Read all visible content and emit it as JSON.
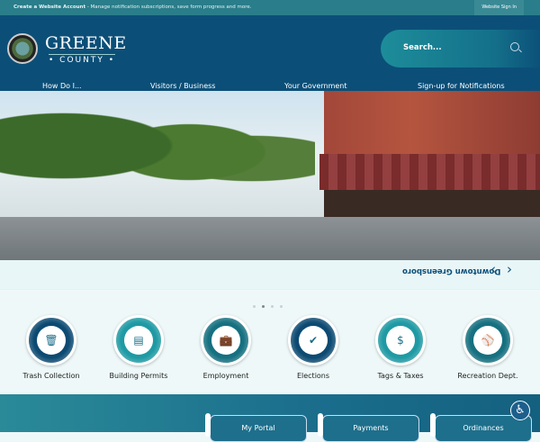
{
  "topbar": {
    "account_label": "Create a Website Account",
    "account_desc": " - Manage notification subscriptions, save form progress and more.",
    "signin": "Website Sign In"
  },
  "logo": {
    "line1": "GREENE",
    "line2": "• COUNTY •"
  },
  "search": {
    "placeholder": "Search..."
  },
  "nav": [
    "How Do I...",
    "Visitors / Business",
    "Your Government",
    "Sign-up for Notifications"
  ],
  "hero": {
    "caption": "Downtown Greensboro",
    "slides": 4,
    "active_slide": 2
  },
  "services": [
    {
      "label": "Trash Collection",
      "icon": "trash-icon",
      "glyph": "🗑",
      "color": "#0d4a72"
    },
    {
      "label": "Building Permits",
      "icon": "document-icon",
      "glyph": "▤",
      "color": "#1f9aa4"
    },
    {
      "label": "Employment",
      "icon": "briefcase-search-icon",
      "glyph": "💼",
      "color": "#167080"
    },
    {
      "label": "Elections",
      "icon": "vote-icon",
      "glyph": "✔",
      "color": "#0d4a72"
    },
    {
      "label": "Tags & Taxes",
      "icon": "tax-icon",
      "glyph": "$",
      "color": "#1f9aa4"
    },
    {
      "label": "Recreation Dept.",
      "icon": "baseball-icon",
      "glyph": "⚾",
      "color": "#167080"
    }
  ],
  "quick_links": [
    "My Portal",
    "Payments",
    "Ordinances"
  ]
}
